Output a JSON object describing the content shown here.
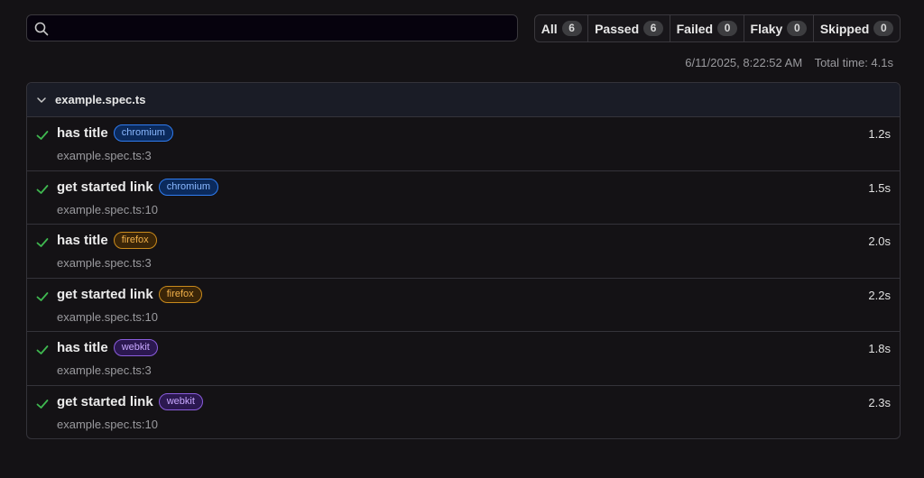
{
  "search": {
    "value": "",
    "placeholder": ""
  },
  "filters": [
    {
      "label": "All",
      "count": "6"
    },
    {
      "label": "Passed",
      "count": "6"
    },
    {
      "label": "Failed",
      "count": "0"
    },
    {
      "label": "Flaky",
      "count": "0"
    },
    {
      "label": "Skipped",
      "count": "0"
    }
  ],
  "meta": {
    "timestamp": "6/11/2025, 8:22:52 AM",
    "total_time": "Total time: 4.1s"
  },
  "file": {
    "name": "example.spec.ts",
    "tests": [
      {
        "title": "has title",
        "project": "chromium",
        "location": "example.spec.ts:3",
        "duration": "1.2s",
        "status": "passed"
      },
      {
        "title": "get started link",
        "project": "chromium",
        "location": "example.spec.ts:10",
        "duration": "1.5s",
        "status": "passed"
      },
      {
        "title": "has title",
        "project": "firefox",
        "location": "example.spec.ts:3",
        "duration": "2.0s",
        "status": "passed"
      },
      {
        "title": "get started link",
        "project": "firefox",
        "location": "example.spec.ts:10",
        "duration": "2.2s",
        "status": "passed"
      },
      {
        "title": "has title",
        "project": "webkit",
        "location": "example.spec.ts:3",
        "duration": "1.8s",
        "status": "passed"
      },
      {
        "title": "get started link",
        "project": "webkit",
        "location": "example.spec.ts:10",
        "duration": "2.3s",
        "status": "passed"
      }
    ]
  },
  "icons": {
    "search": "search-icon",
    "expand": "chevron-down-icon",
    "passed": "check-icon"
  },
  "colors": {
    "passed": "#3fb950",
    "chromium": "#2f7cf0",
    "firefox": "#c98a1c",
    "webkit": "#8a5cdc"
  }
}
